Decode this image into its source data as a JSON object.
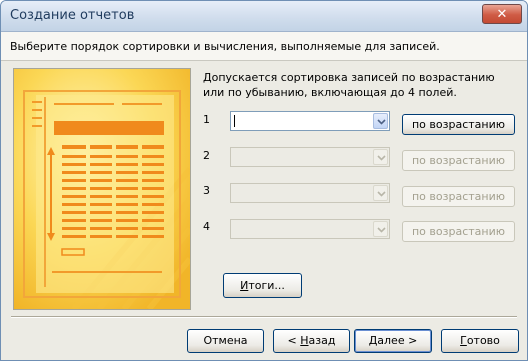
{
  "window": {
    "title": "Создание отчетов",
    "close_glyph": "✕"
  },
  "instruction": "Выберите порядок сортировки и вычисления, выполняемые для записей.",
  "sort_description": "Допускается сортировка записей по возрастанию или по убыванию, включающая до 4 полей.",
  "sort_rows": [
    {
      "number": "1",
      "field_value": "",
      "order_label": "по возрастанию",
      "enabled": true
    },
    {
      "number": "2",
      "field_value": "",
      "order_label": "по возрастанию",
      "enabled": false
    },
    {
      "number": "3",
      "field_value": "",
      "order_label": "по возрастанию",
      "enabled": false
    },
    {
      "number": "4",
      "field_value": "",
      "order_label": "по возрастанию",
      "enabled": false
    }
  ],
  "summary_button": {
    "label_access_key": "И",
    "label_rest": "тоги..."
  },
  "footer": {
    "cancel": "Отмена",
    "back_prefix": "< ",
    "back_access_key": "Н",
    "back_rest": "азад",
    "next_access_key": "Д",
    "next_rest": "алее >",
    "finish_access_key": "Г",
    "finish_rest": "отово"
  },
  "colors": {
    "illustration_bg": "#f8cf48",
    "illustration_accent": "#f08a1c",
    "title_text": "#1f3b5e"
  }
}
